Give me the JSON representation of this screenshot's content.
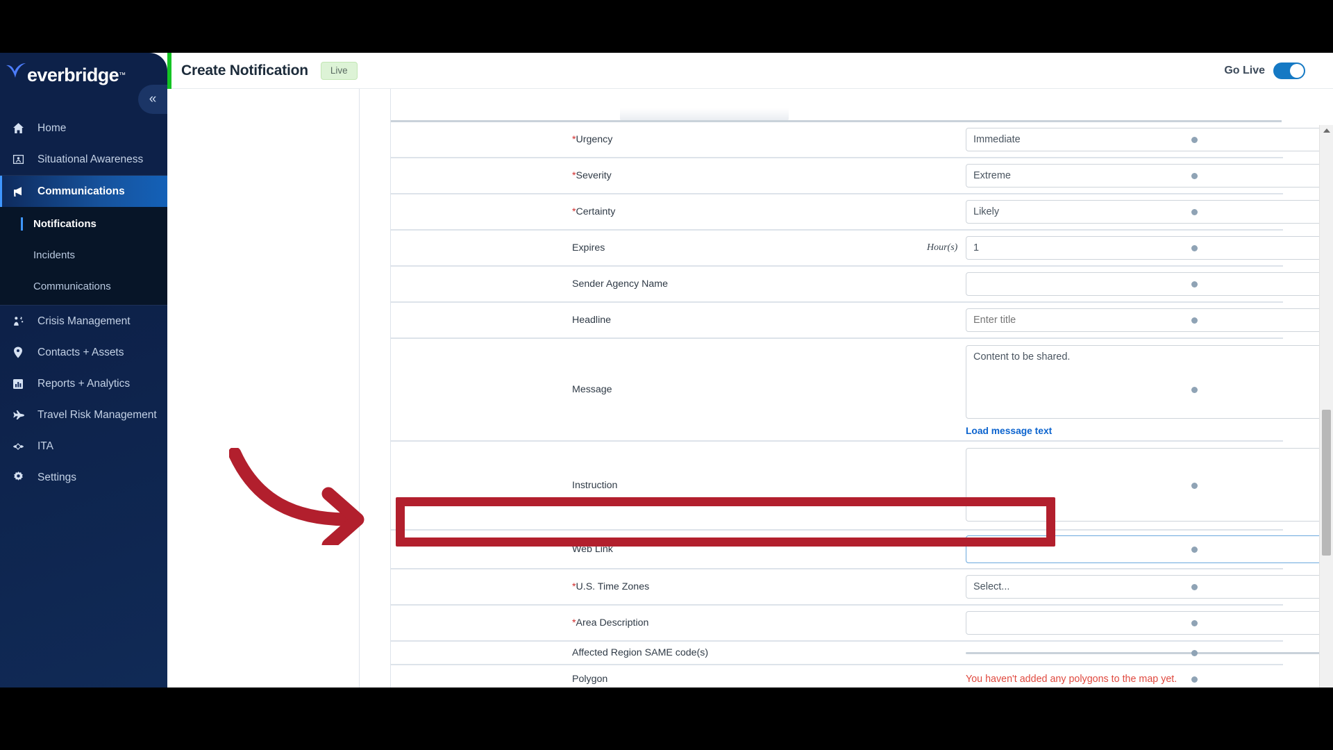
{
  "app": {
    "brand": "everbridge",
    "brand_tm": "™",
    "collapse_icon": "«"
  },
  "header": {
    "title": "Create Notification",
    "status_badge": "Live",
    "go_live_label": "Go Live",
    "toggle_state": "on",
    "accent_green": "#14c324",
    "toggle_color": "#1579c4"
  },
  "sidebar": {
    "items": [
      {
        "label": "Home",
        "icon": "home-icon",
        "active": false
      },
      {
        "label": "Situational Awareness",
        "icon": "map-person-icon",
        "active": false
      },
      {
        "label": "Communications",
        "icon": "megaphone-icon",
        "active": true
      },
      {
        "label": "Crisis Management",
        "icon": "crisis-people-icon",
        "active": false
      },
      {
        "label": "Contacts + Assets",
        "icon": "map-pin-icon",
        "active": false
      },
      {
        "label": "Reports + Analytics",
        "icon": "bar-chart-icon",
        "active": false
      },
      {
        "label": "Travel Risk Management",
        "icon": "airplane-icon",
        "active": false
      },
      {
        "label": "ITA",
        "icon": "network-nodes-icon",
        "active": false
      },
      {
        "label": "Settings",
        "icon": "gear-icon",
        "active": false
      }
    ],
    "subitems": [
      {
        "label": "Notifications",
        "active": true
      },
      {
        "label": "Incidents",
        "active": false
      },
      {
        "label": "Communications",
        "active": false
      }
    ]
  },
  "form": {
    "rows": [
      {
        "label": "Urgency",
        "required": true,
        "type": "select",
        "value": "Immediate"
      },
      {
        "label": "Severity",
        "required": true,
        "type": "select",
        "value": "Extreme"
      },
      {
        "label": "Certainty",
        "required": true,
        "type": "select",
        "value": "Likely"
      },
      {
        "label": "Expires",
        "required": false,
        "type": "select",
        "value": "1",
        "unit": "Hour(s)"
      },
      {
        "label": "Sender Agency Name",
        "required": false,
        "type": "select",
        "value": ""
      },
      {
        "label": "Headline",
        "required": false,
        "type": "text",
        "value": "",
        "placeholder": "Enter title"
      },
      {
        "label": "Message",
        "required": false,
        "type": "textarea",
        "value": "Content to be shared.",
        "helper_link": "Load message text"
      },
      {
        "label": "Instruction",
        "required": false,
        "type": "textarea",
        "value": ""
      },
      {
        "label": "Web Link",
        "required": false,
        "type": "text-focused",
        "value": ""
      },
      {
        "label": "U.S. Time Zones",
        "required": true,
        "type": "select",
        "value": "Select..."
      },
      {
        "label": "Area Description",
        "required": true,
        "type": "text",
        "value": "",
        "has_info": true
      },
      {
        "label": "Affected Region SAME code(s)",
        "required": false,
        "type": "flatline",
        "value": ""
      },
      {
        "label": "Polygon",
        "required": false,
        "type": "warning",
        "value": "You haven't added any polygons to the map yet."
      }
    ]
  },
  "annotation": {
    "highlight_color": "#b21f2d",
    "arrow_color": "#b21f2d",
    "target_field": "Web Link"
  }
}
